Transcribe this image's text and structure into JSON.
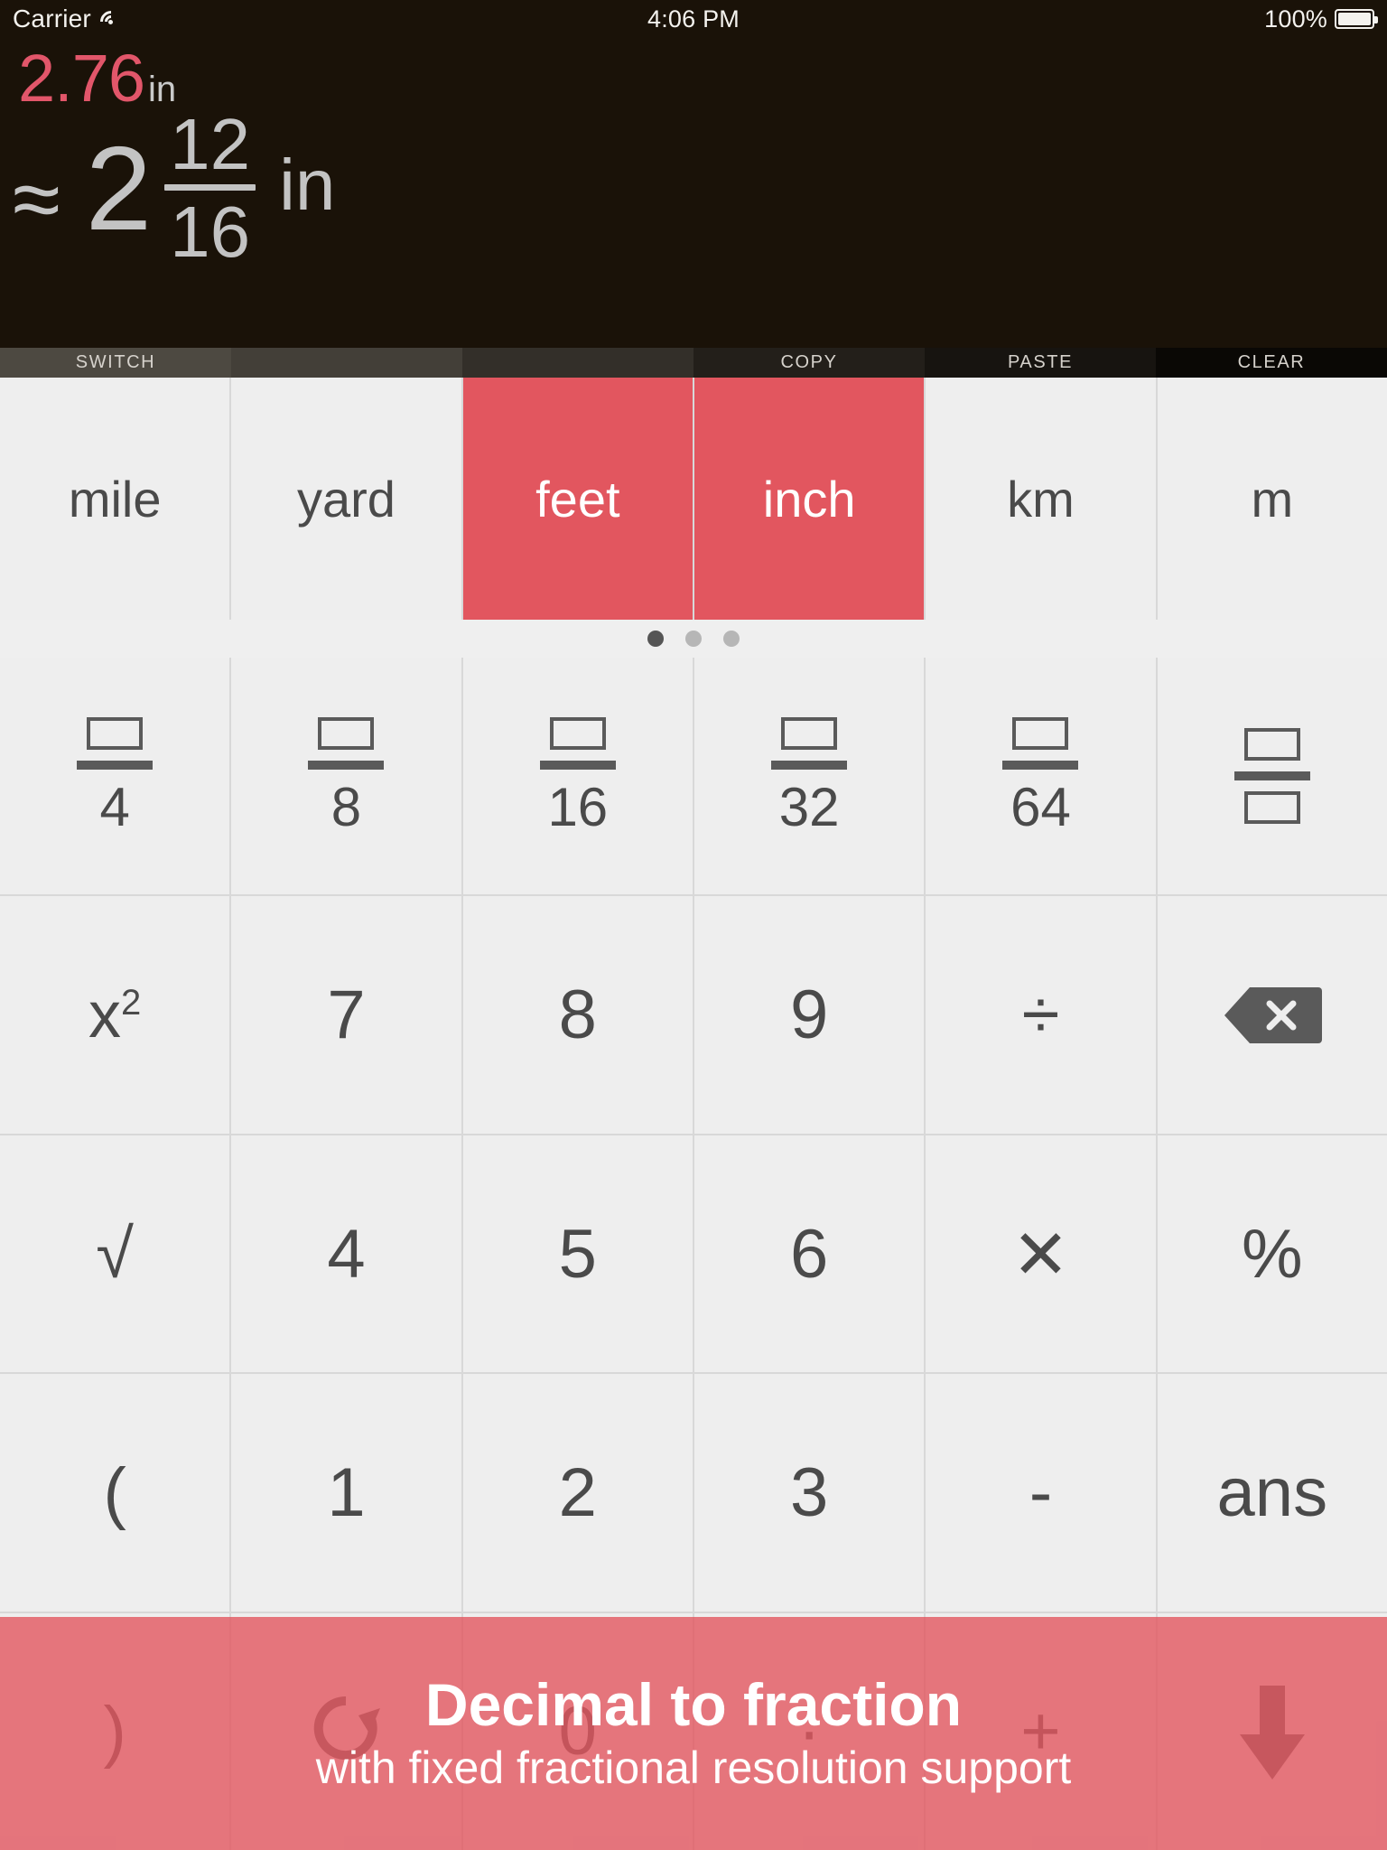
{
  "statusbar": {
    "carrier": "Carrier",
    "wifi_icon": "wifi-icon",
    "time": "4:06 PM",
    "battery_percent": "100%",
    "battery_icon": "battery-full-icon"
  },
  "display": {
    "background_color": "#1a1208",
    "input_value": "2.76",
    "input_unit": "in",
    "input_color": "#e2566a",
    "result_approx_symbol": "≈",
    "result_whole": "2",
    "result_numerator": "12",
    "result_denominator": "16",
    "result_unit": "in",
    "result_color": "#c3c3c3"
  },
  "toolbar": {
    "items": [
      {
        "label": "SWITCH"
      },
      {
        "label": ""
      },
      {
        "label": ""
      },
      {
        "label": "COPY"
      },
      {
        "label": "PASTE"
      },
      {
        "label": "CLEAR"
      }
    ]
  },
  "units": {
    "selected_color": "#e2565f",
    "items": [
      {
        "label": "mile",
        "selected": false
      },
      {
        "label": "yard",
        "selected": false
      },
      {
        "label": "feet",
        "selected": true
      },
      {
        "label": "inch",
        "selected": true
      },
      {
        "label": "km",
        "selected": false
      },
      {
        "label": "m",
        "selected": false
      }
    ]
  },
  "pager": {
    "count": 3,
    "active_index": 0
  },
  "fraction_row": {
    "items": [
      {
        "denominator": "4",
        "icon": "fraction-box-over-4-icon"
      },
      {
        "denominator": "8",
        "icon": "fraction-box-over-8-icon"
      },
      {
        "denominator": "16",
        "icon": "fraction-box-over-16-icon"
      },
      {
        "denominator": "32",
        "icon": "fraction-box-over-32-icon"
      },
      {
        "denominator": "64",
        "icon": "fraction-box-over-64-icon"
      },
      {
        "denominator": "",
        "icon": "fraction-box-over-box-icon"
      }
    ]
  },
  "keypad": {
    "rows": [
      [
        {
          "name": "square",
          "label": "x",
          "sup": "2"
        },
        {
          "name": "digit-7",
          "label": "7"
        },
        {
          "name": "digit-8",
          "label": "8"
        },
        {
          "name": "digit-9",
          "label": "9"
        },
        {
          "name": "divide",
          "label": "÷"
        },
        {
          "name": "backspace",
          "label": "",
          "icon": "backspace-icon"
        }
      ],
      [
        {
          "name": "square-root",
          "label": "√"
        },
        {
          "name": "digit-4",
          "label": "4"
        },
        {
          "name": "digit-5",
          "label": "5"
        },
        {
          "name": "digit-6",
          "label": "6"
        },
        {
          "name": "multiply",
          "label": "✕"
        },
        {
          "name": "percent",
          "label": "%"
        }
      ],
      [
        {
          "name": "paren-open",
          "label": "("
        },
        {
          "name": "digit-1",
          "label": "1"
        },
        {
          "name": "digit-2",
          "label": "2"
        },
        {
          "name": "digit-3",
          "label": "3"
        },
        {
          "name": "minus",
          "label": "-"
        },
        {
          "name": "answer",
          "label": "ans"
        }
      ],
      [
        {
          "name": "paren-close",
          "label": ")"
        },
        {
          "name": "undo",
          "label": "↺",
          "icon": "undo-icon"
        },
        {
          "name": "digit-0",
          "label": "0"
        },
        {
          "name": "decimal-point",
          "label": "·"
        },
        {
          "name": "plus",
          "label": "+"
        },
        {
          "name": "enter-down",
          "label": "↓",
          "icon": "arrow-down-icon"
        }
      ]
    ]
  },
  "banner": {
    "title": "Decimal to fraction",
    "subtitle": "with fixed fractional resolution support",
    "background_color": "#e2565f"
  }
}
